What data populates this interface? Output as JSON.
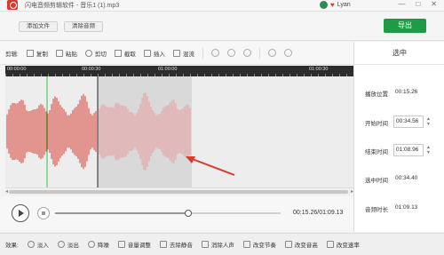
{
  "window": {
    "title": "闪电音频剪辑软件 - 音乐1 (1).mp3",
    "user_name": "Lyan",
    "controls": [
      "—",
      "□",
      "✕"
    ]
  },
  "actionbar": {
    "add_file": "添加文件",
    "clear_audio": "清除音频",
    "export": "导出"
  },
  "toolbar": {
    "label": "剪辑:",
    "tools": [
      {
        "name": "copy",
        "label": "复制"
      },
      {
        "name": "paste",
        "label": "粘贴"
      },
      {
        "name": "cut",
        "label": "剪切"
      },
      {
        "name": "trim",
        "label": "截取"
      },
      {
        "name": "insert",
        "label": "插入"
      },
      {
        "name": "mix",
        "label": "混流"
      }
    ]
  },
  "ruler": {
    "labels": [
      "00:00:00",
      "00:00:30",
      "01:00:00",
      "01:00:30"
    ]
  },
  "selection_panel": {
    "title": "选中",
    "play_position_label": "播放位置",
    "play_position": "00:15.26",
    "start_label": "开始时间",
    "start_value": "00:34.56",
    "end_label": "结束时间",
    "end_value": "01:08.96",
    "duration_label": "选中时间",
    "duration_value": "00:34.40",
    "audio_length_label": "音频时长",
    "audio_length_value": "01:09.13"
  },
  "player": {
    "time_readout": "00:15.26/01:09.13",
    "progress_fraction": 0.592
  },
  "effects": {
    "label": "效果:",
    "items": [
      {
        "name": "fade-in",
        "label": "淡入"
      },
      {
        "name": "fade-out",
        "label": "淡出"
      },
      {
        "name": "noise-reduction",
        "label": "降噪"
      },
      {
        "name": "volume",
        "label": "音量调整"
      },
      {
        "name": "remove-silence",
        "label": "去除静音"
      },
      {
        "name": "remove-vocal",
        "label": "消除人声"
      },
      {
        "name": "tempo",
        "label": "改变节奏"
      },
      {
        "name": "pitch",
        "label": "改变音高"
      },
      {
        "name": "speed",
        "label": "改变速率"
      }
    ]
  },
  "colors": {
    "accent": "#1f9a47",
    "wave_red": "#d83a2e",
    "wave_pink": "#e89a9a",
    "selection_bg": "#d9d9d9",
    "playhead": "#39c14a",
    "arrow": "#d83a2e"
  }
}
